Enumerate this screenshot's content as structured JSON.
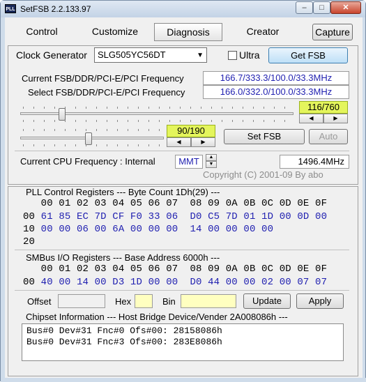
{
  "window": {
    "title": "SetFSB 2.2.133.97",
    "icon_text": "PLL",
    "min": "–",
    "max": "□",
    "close": "✕"
  },
  "tabs": [
    "Control",
    "Customize",
    "Diagnosis",
    "Creator"
  ],
  "capture_label": "Capture",
  "clock": {
    "label": "Clock Generator",
    "selected": "SLG505YC56DT",
    "ultra_label": "Ultra",
    "get_fsb_label": "Get FSB"
  },
  "freq": {
    "current_label": "Current FSB/DDR/PCI-E/PCI Frequency",
    "current_value": "166.7/333.3/100.0/33.3MHz",
    "select_label": "Select FSB/DDR/PCI-E/PCI Frequency",
    "select_value": "166.0/332.0/100.0/33.3MHz"
  },
  "slider1": {
    "value_text": "116/760",
    "value": 116,
    "max": 760
  },
  "slider2": {
    "value_text": "90/190",
    "value": 90,
    "max": 190
  },
  "set_fsb_label": "Set FSB",
  "auto_label": "Auto",
  "cpu": {
    "label": "Current CPU Frequency : Internal",
    "mode": "MMT",
    "value": "1496.4MHz"
  },
  "copyright": "Copyright (C) 2001-09 By abo",
  "pll": {
    "header": "PLL Control Registers  --- Byte Count 1Dh(29) ---",
    "cols": "   00 01 02 03 04 05 06 07  08 09 0A 0B 0C 0D 0E 0F",
    "rows": [
      {
        "addr": "00",
        "bytes": " 61 85 EC 7D CF F0 33 06  D0 C5 7D 01 1D 00 0D 00"
      },
      {
        "addr": "10",
        "bytes": " 00 00 06 00 6A 00 00 00  14 00 00 00 00"
      },
      {
        "addr": "20",
        "bytes": ""
      }
    ]
  },
  "smbus": {
    "header": "SMBus I/O Registers  --- Base Address 6000h ---",
    "cols": "   00 01 02 03 04 05 06 07  08 09 0A 0B 0C 0D 0E 0F",
    "rows": [
      {
        "addr": "00",
        "bytes": " 40 00 14 00 D3 1D 00 00  D0 44 00 00 02 00 07 07"
      }
    ]
  },
  "edit": {
    "offset_label": "Offset",
    "hex_label": "Hex",
    "bin_label": "Bin",
    "update_label": "Update",
    "apply_label": "Apply"
  },
  "chipset": {
    "header": "Chipset Information  --- Host Bridge Device/Vender 2A008086h ---",
    "lines": [
      "Bus#0 Dev#31 Fnc#0 Ofs#00: 28158086h",
      "Bus#0 Dev#31 Fnc#3 Ofs#00: 283E8086h"
    ]
  }
}
